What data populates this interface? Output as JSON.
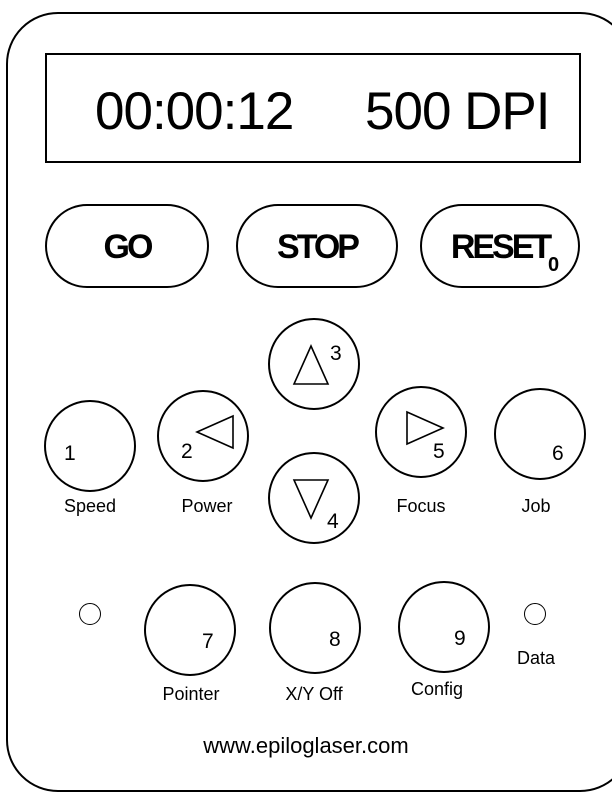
{
  "display": {
    "time": "00:00:12",
    "dpi": "500 DPI"
  },
  "top_buttons": [
    {
      "label": "GO",
      "digit": ""
    },
    {
      "label": "STOP",
      "digit": ""
    },
    {
      "label": "RESET",
      "digit": "0"
    }
  ],
  "keys": [
    {
      "digit": "1",
      "caption": "Speed"
    },
    {
      "digit": "2",
      "caption": "Power",
      "icon": "arrow-left-icon"
    },
    {
      "digit": "3",
      "caption": "",
      "icon": "arrow-up-icon"
    },
    {
      "digit": "4",
      "caption": "",
      "icon": "arrow-down-icon"
    },
    {
      "digit": "5",
      "caption": "Focus",
      "icon": "arrow-right-icon"
    },
    {
      "digit": "6",
      "caption": "Job"
    },
    {
      "digit": "7",
      "caption": "Pointer"
    },
    {
      "digit": "8",
      "caption": "X/Y Off"
    },
    {
      "digit": "9",
      "caption": "Config"
    }
  ],
  "indicator": {
    "data_label": "Data"
  },
  "footer": {
    "url": "www.epiloglaser.com"
  }
}
